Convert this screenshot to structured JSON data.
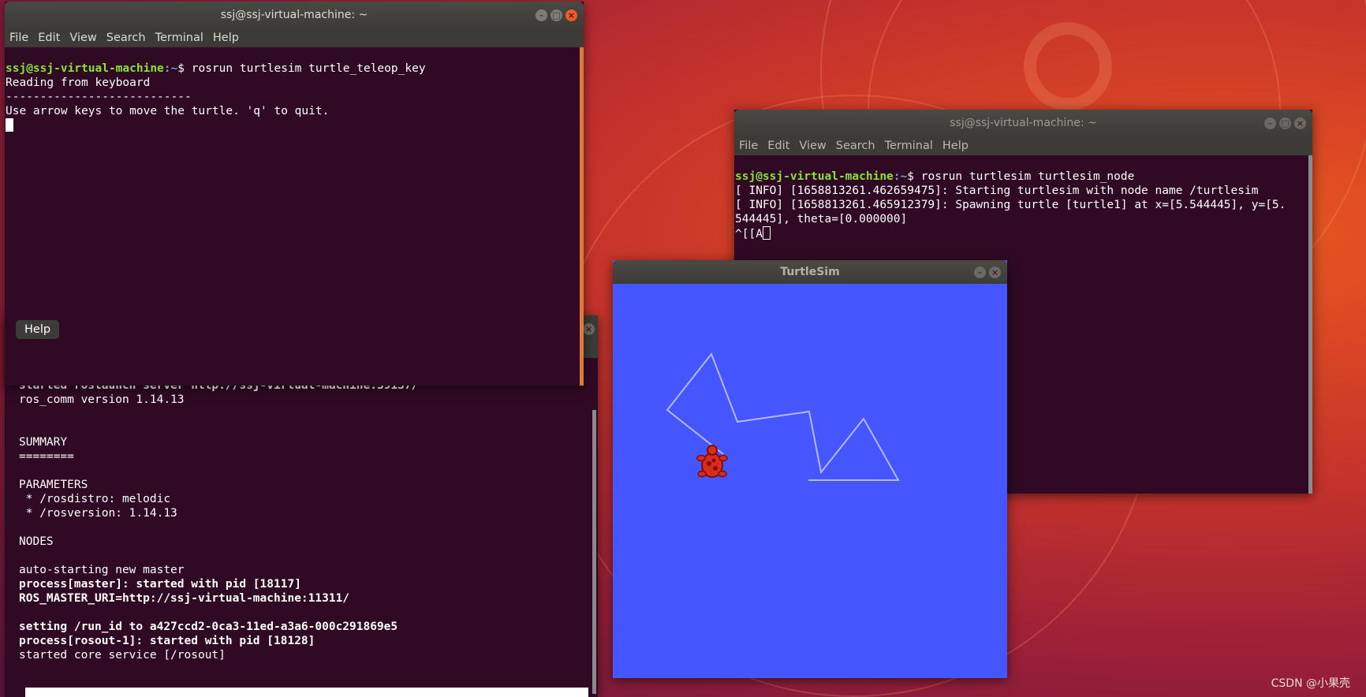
{
  "colors": {
    "terminal_bg": "#300a24",
    "prompt_user": "#8ae234",
    "prompt_path": "#729fcf",
    "turtlesim_bg": "#4556ff",
    "trail": "#b3b8ff",
    "turtle": "#dc2a1c"
  },
  "terminal_teleop": {
    "title": "ssj@ssj-virtual-machine: ~",
    "menu": [
      "File",
      "Edit",
      "View",
      "Search",
      "Terminal",
      "Help"
    ],
    "prompt_user": "ssj@ssj-virtual-machine",
    "prompt_path": ":~",
    "prompt_symbol": "$ ",
    "command": "rosrun turtlesim turtle_teleop_key",
    "lines": [
      "Reading from keyboard",
      "---------------------------",
      "Use arrow keys to move the turtle. 'q' to quit."
    ],
    "tooltip": "Help"
  },
  "terminal_roscore": {
    "lines": [
      {
        "text": "started roslaunch server http://ssj-virtual-machine:39137/",
        "bold": true
      },
      {
        "text": "ros_comm version 1.14.13",
        "bold": false
      },
      {
        "text": "",
        "bold": false
      },
      {
        "text": "",
        "bold": false
      },
      {
        "text": "SUMMARY",
        "bold": false
      },
      {
        "text": "========",
        "bold": false
      },
      {
        "text": "",
        "bold": false
      },
      {
        "text": "PARAMETERS",
        "bold": false
      },
      {
        "text": " * /rosdistro: melodic",
        "bold": false
      },
      {
        "text": " * /rosversion: 1.14.13",
        "bold": false
      },
      {
        "text": "",
        "bold": false
      },
      {
        "text": "NODES",
        "bold": false
      },
      {
        "text": "",
        "bold": false
      },
      {
        "text": "auto-starting new master",
        "bold": false
      },
      {
        "text": "process[master]: started with pid [18117]",
        "bold": true
      },
      {
        "text": "ROS_MASTER_URI=http://ssj-virtual-machine:11311/",
        "bold": true
      },
      {
        "text": "",
        "bold": false
      },
      {
        "text": "setting /run_id to a427ccd2-0ca3-11ed-a3a6-000c291869e5",
        "bold": true
      },
      {
        "text": "process[rosout-1]: started with pid [18128]",
        "bold": true
      },
      {
        "text": "started core service [/rosout]",
        "bold": false
      }
    ]
  },
  "terminal_node": {
    "title": "ssj@ssj-virtual-machine: ~",
    "menu": [
      "File",
      "Edit",
      "View",
      "Search",
      "Terminal",
      "Help"
    ],
    "prompt_user": "ssj@ssj-virtual-machine",
    "prompt_path": ":~",
    "prompt_symbol": "$ ",
    "command": "rosrun turtlesim turtlesim_node",
    "lines": [
      "[ INFO] [1658813261.462659475]: Starting turtlesim with node name /turtlesim",
      "[ INFO] [1658813261.465912379]: Spawning turtle [turtle1] at x=[5.544445], y=[5.",
      "544445], theta=[0.000000]",
      "^[[A"
    ]
  },
  "turtlesim": {
    "title": "TurtleSim"
  },
  "watermark": "CSDN @小果壳"
}
